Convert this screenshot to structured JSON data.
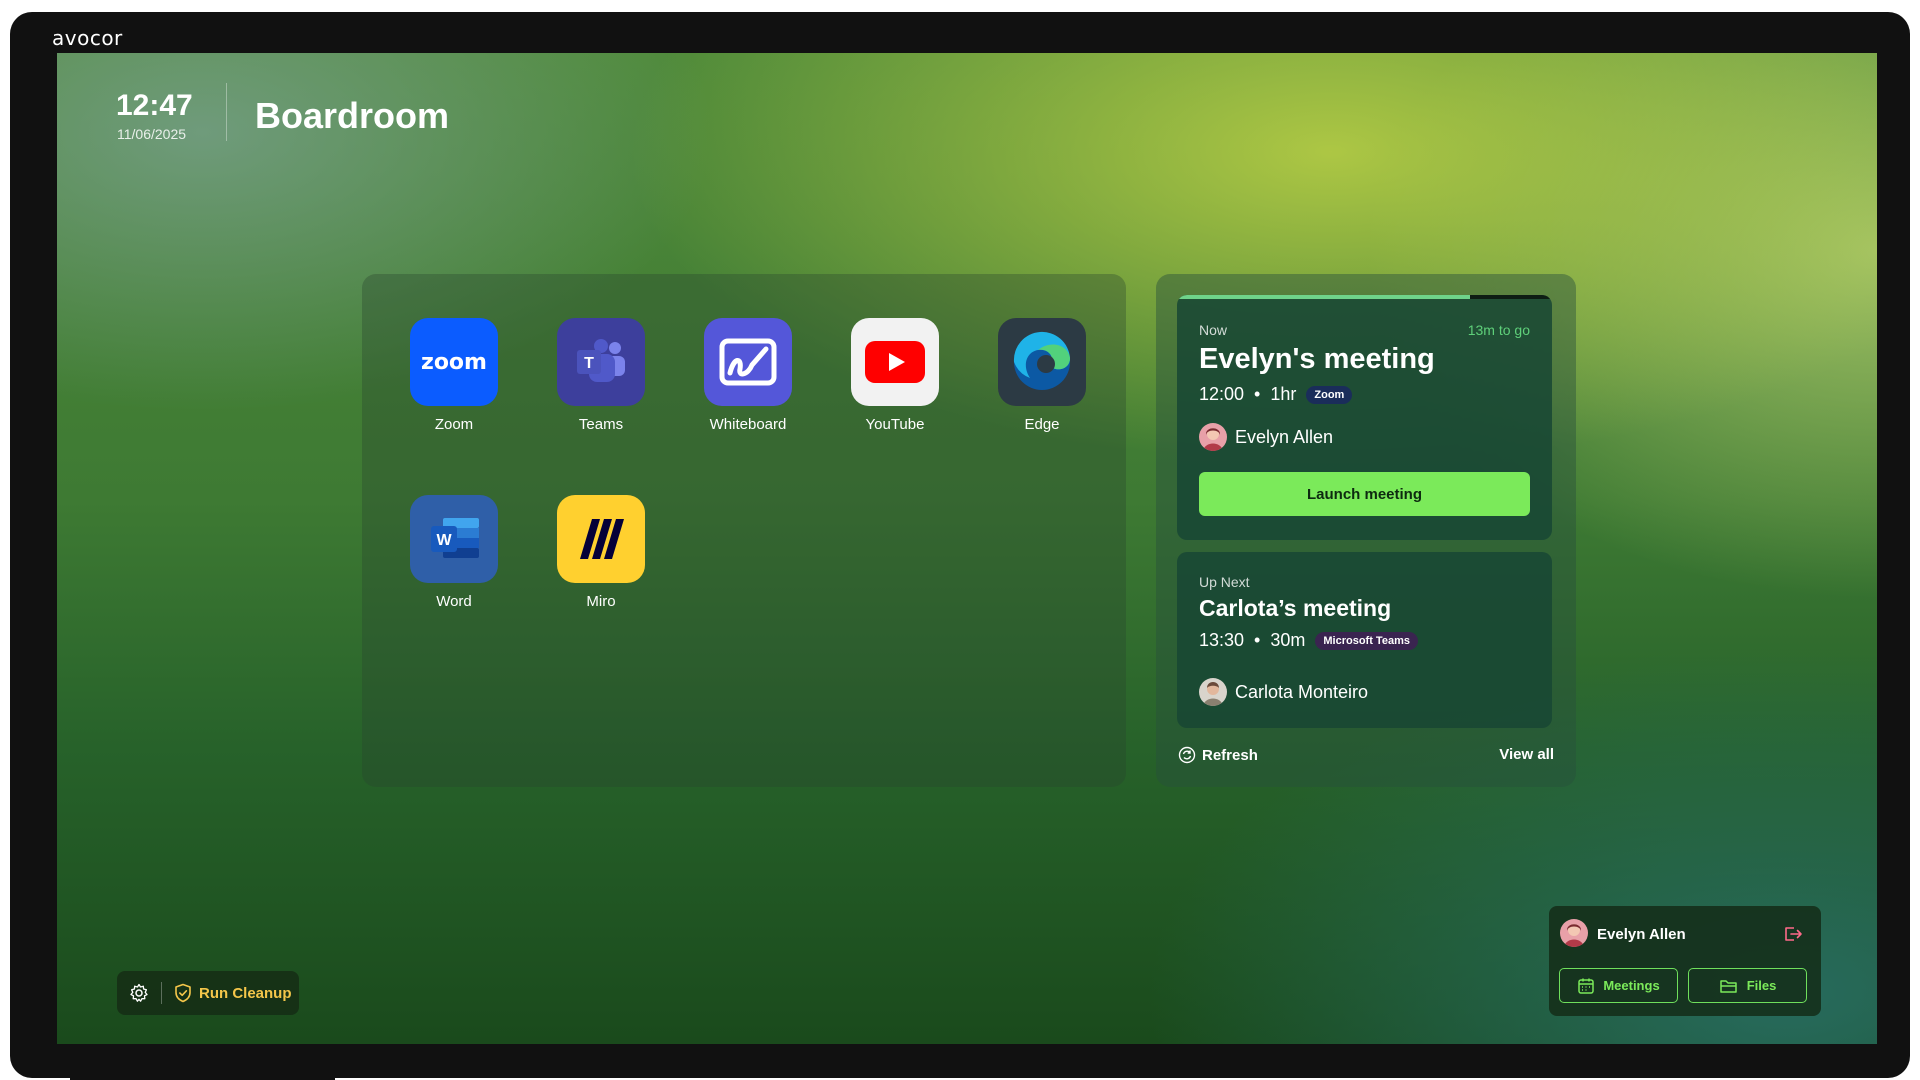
{
  "device": {
    "brand": "avocor"
  },
  "header": {
    "time": "12:47",
    "date": "11/06/2025",
    "room": "Boardroom"
  },
  "apps": [
    {
      "label": "Zoom",
      "icon": "zoom-icon",
      "color": "#0b5cff"
    },
    {
      "label": "Teams",
      "icon": "teams-icon",
      "color": "#4b53bc"
    },
    {
      "label": "Whiteboard",
      "icon": "whiteboard-icon",
      "color": "#5b5fe0"
    },
    {
      "label": "YouTube",
      "icon": "youtube-icon",
      "color": "#ff0000"
    },
    {
      "label": "Edge",
      "icon": "edge-icon",
      "color": "#1fa3e3"
    },
    {
      "label": "Word",
      "icon": "word-icon",
      "color": "#2b5797"
    },
    {
      "label": "Miro",
      "icon": "miro-icon",
      "color": "#ffd02f"
    }
  ],
  "meetings": {
    "now": {
      "label": "Now",
      "remaining": "13m to go",
      "progress": 0.78,
      "title": "Evelyn's meeting",
      "start": "12:00",
      "duration": "1hr",
      "platform": "Zoom",
      "host": "Evelyn Allen",
      "action": "Launch meeting"
    },
    "next": {
      "label": "Up Next",
      "title": "Carlota’s meeting",
      "start": "13:30",
      "duration": "30m",
      "platform": "Microsoft Teams",
      "host": "Carlota Monteiro"
    },
    "refresh_label": "Refresh",
    "view_all_label": "View all"
  },
  "footer": {
    "cleanup_label": "Run Cleanup"
  },
  "user": {
    "name": "Evelyn Allen",
    "meetings_label": "Meetings",
    "files_label": "Files"
  },
  "colors": {
    "accent_green": "#7bea5a",
    "cleanup_yellow": "#f4c64a"
  }
}
